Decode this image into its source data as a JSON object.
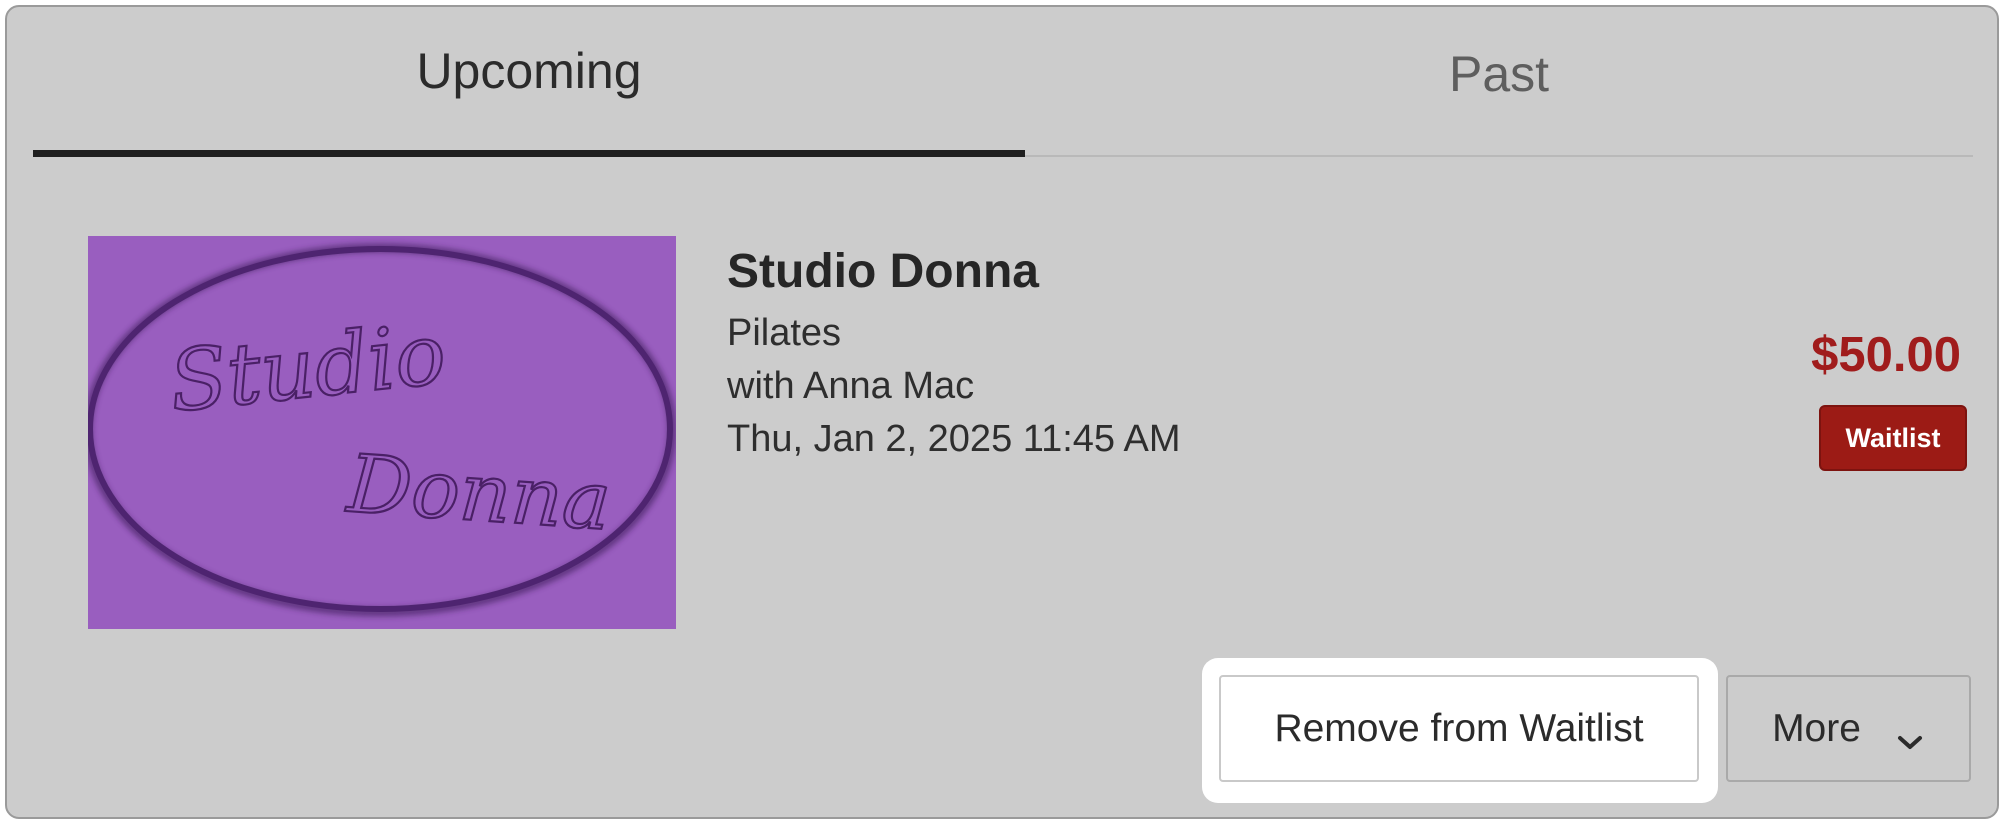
{
  "tabs": [
    {
      "label": "Upcoming",
      "active": true
    },
    {
      "label": "Past",
      "active": false
    }
  ],
  "booking": {
    "studio": "Studio Donna",
    "class_name": "Pilates",
    "instructor": "with Anna Mac",
    "datetime": "Thu, Jan 2, 2025 11:45 AM",
    "price": "$50.00",
    "status": "Waitlist",
    "logo_text": "Studio Donna"
  },
  "actions": {
    "remove_label": "Remove from Waitlist",
    "more_label": "More"
  },
  "icons": {
    "more_dropdown": "chevron-down-icon"
  },
  "colors": {
    "panel_bg": "#cccccc",
    "logo_bg": "#995ebf",
    "logo_ring": "#4e2470",
    "price": "#a01c1c",
    "badge_bg": "#9c1b15",
    "active_tab_underline": "#1f1f1f"
  }
}
